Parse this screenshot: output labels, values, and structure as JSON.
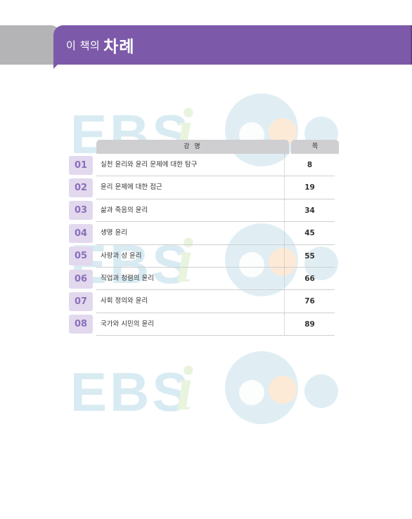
{
  "header": {
    "subtitle": "이 책의",
    "title": "차례"
  },
  "watermark": {
    "text": "EBSi",
    "colors": {
      "letters": "#b9dbe8",
      "i": "#d8ecc4",
      "circle": "#c7e1ec",
      "orange": "#fad9b8"
    }
  },
  "table": {
    "title_header": "강 명",
    "page_header": "쪽",
    "rows": [
      {
        "num": "01",
        "title": "실천 윤리와 윤리 문제에 대한 탐구",
        "page": "8"
      },
      {
        "num": "02",
        "title": "윤리 문제에 대한 접근",
        "page": "19"
      },
      {
        "num": "03",
        "title": "삶과 죽음의 윤리",
        "page": "34"
      },
      {
        "num": "04",
        "title": "생명 윤리",
        "page": "45"
      },
      {
        "num": "05",
        "title": "사랑과 성 윤리",
        "page": "55"
      },
      {
        "num": "06",
        "title": "직업과 청렴의 윤리",
        "page": "66"
      },
      {
        "num": "07",
        "title": "사회 정의와 윤리",
        "page": "76"
      },
      {
        "num": "08",
        "title": "국가와 시민의 윤리",
        "page": "89"
      }
    ]
  },
  "colors": {
    "accent": "#7c5aa9",
    "number_bg": "#e2d9ee",
    "number_text": "#8b6fbb",
    "header_bg": "#cfcfd2"
  }
}
